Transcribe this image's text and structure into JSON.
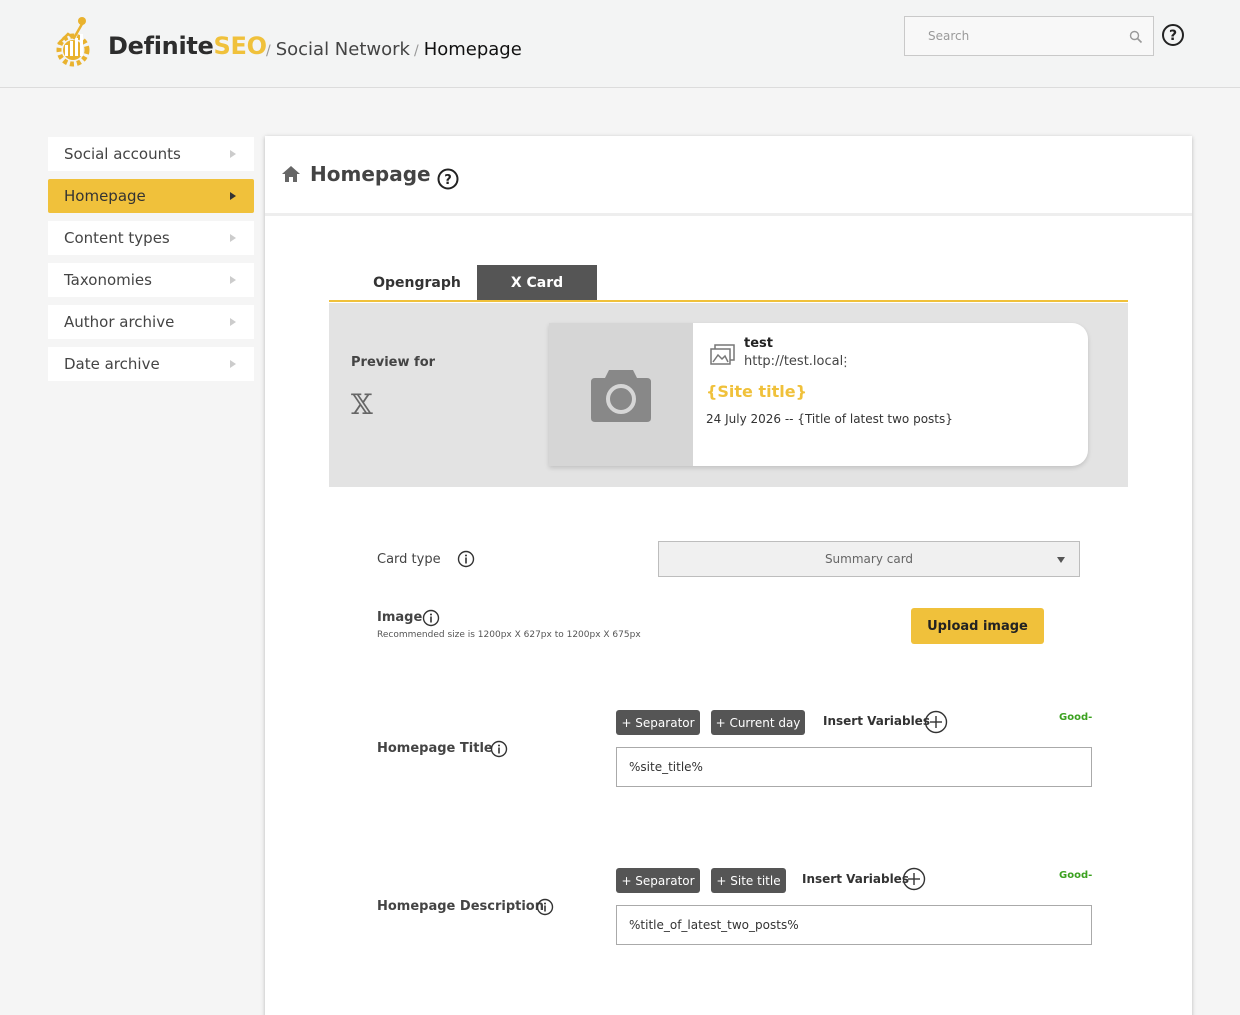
{
  "header": {
    "brand_part1": "Definite",
    "brand_part2": "SEO",
    "brand_color": "#f0c13b",
    "breadcrumb": [
      "Social Network",
      "Homepage"
    ],
    "breadcrumb_sep": "/",
    "search_placeholder": "Search",
    "search_icon": "search-icon",
    "help_icon": "help-circle-icon"
  },
  "sidebar": {
    "items": [
      {
        "label": "Social accounts",
        "active": false
      },
      {
        "label": "Homepage",
        "active": true
      },
      {
        "label": "Content types",
        "active": false
      },
      {
        "label": "Taxonomies",
        "active": false
      },
      {
        "label": "Author archive",
        "active": false
      },
      {
        "label": "Date archive",
        "active": false
      }
    ]
  },
  "panel": {
    "title": "Homepage",
    "icon": "home-icon",
    "tabs": [
      {
        "label": "Opengraph",
        "active": false
      },
      {
        "label": "X Card",
        "active": true
      }
    ],
    "preview": {
      "label": "Preview for",
      "platform_logo": "𝕏",
      "site_name": "test",
      "site_url": "http://test.local",
      "menu_glyph": "⋮",
      "title": "{Site title}",
      "description": "24 July 2026 -- {Title of latest two posts}"
    },
    "card_type": {
      "label": "Card type",
      "value": "Summary card"
    },
    "image": {
      "label": "Image",
      "hint": "Recommended size is 1200px X 627px to 1200px X 675px",
      "button": "Upload image"
    },
    "homepage_title": {
      "label": "Homepage Title",
      "chips": [
        "+ Separator",
        "+ Current day"
      ],
      "insert_label": "Insert Variables",
      "status": "Good-",
      "value": "%site_title%"
    },
    "homepage_description": {
      "label": "Homepage Description",
      "chips": [
        "+ Separator",
        "+ Site title"
      ],
      "insert_label": "Insert Variables",
      "status": "Good-",
      "value": "%title_of_latest_two_posts%"
    }
  }
}
